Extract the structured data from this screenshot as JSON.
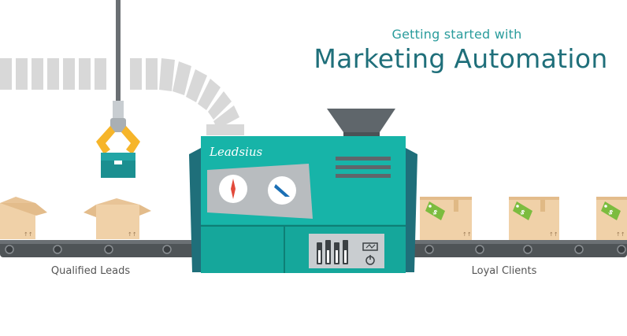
{
  "header": {
    "subtitle": "Getting started with",
    "title": "Marketing Automation"
  },
  "labels": {
    "left": "Qualified Leads",
    "right": "Loyal Clients"
  },
  "machine": {
    "brand": "Leadsius"
  },
  "price_tag": "$",
  "colors": {
    "teal": "#17b4a8",
    "dark_teal": "#1f6f7a",
    "belt": "#5d5d5d",
    "box": "#f0d1a8",
    "tag_green": "#7cbc3f",
    "claw_yellow": "#f6b52a"
  }
}
